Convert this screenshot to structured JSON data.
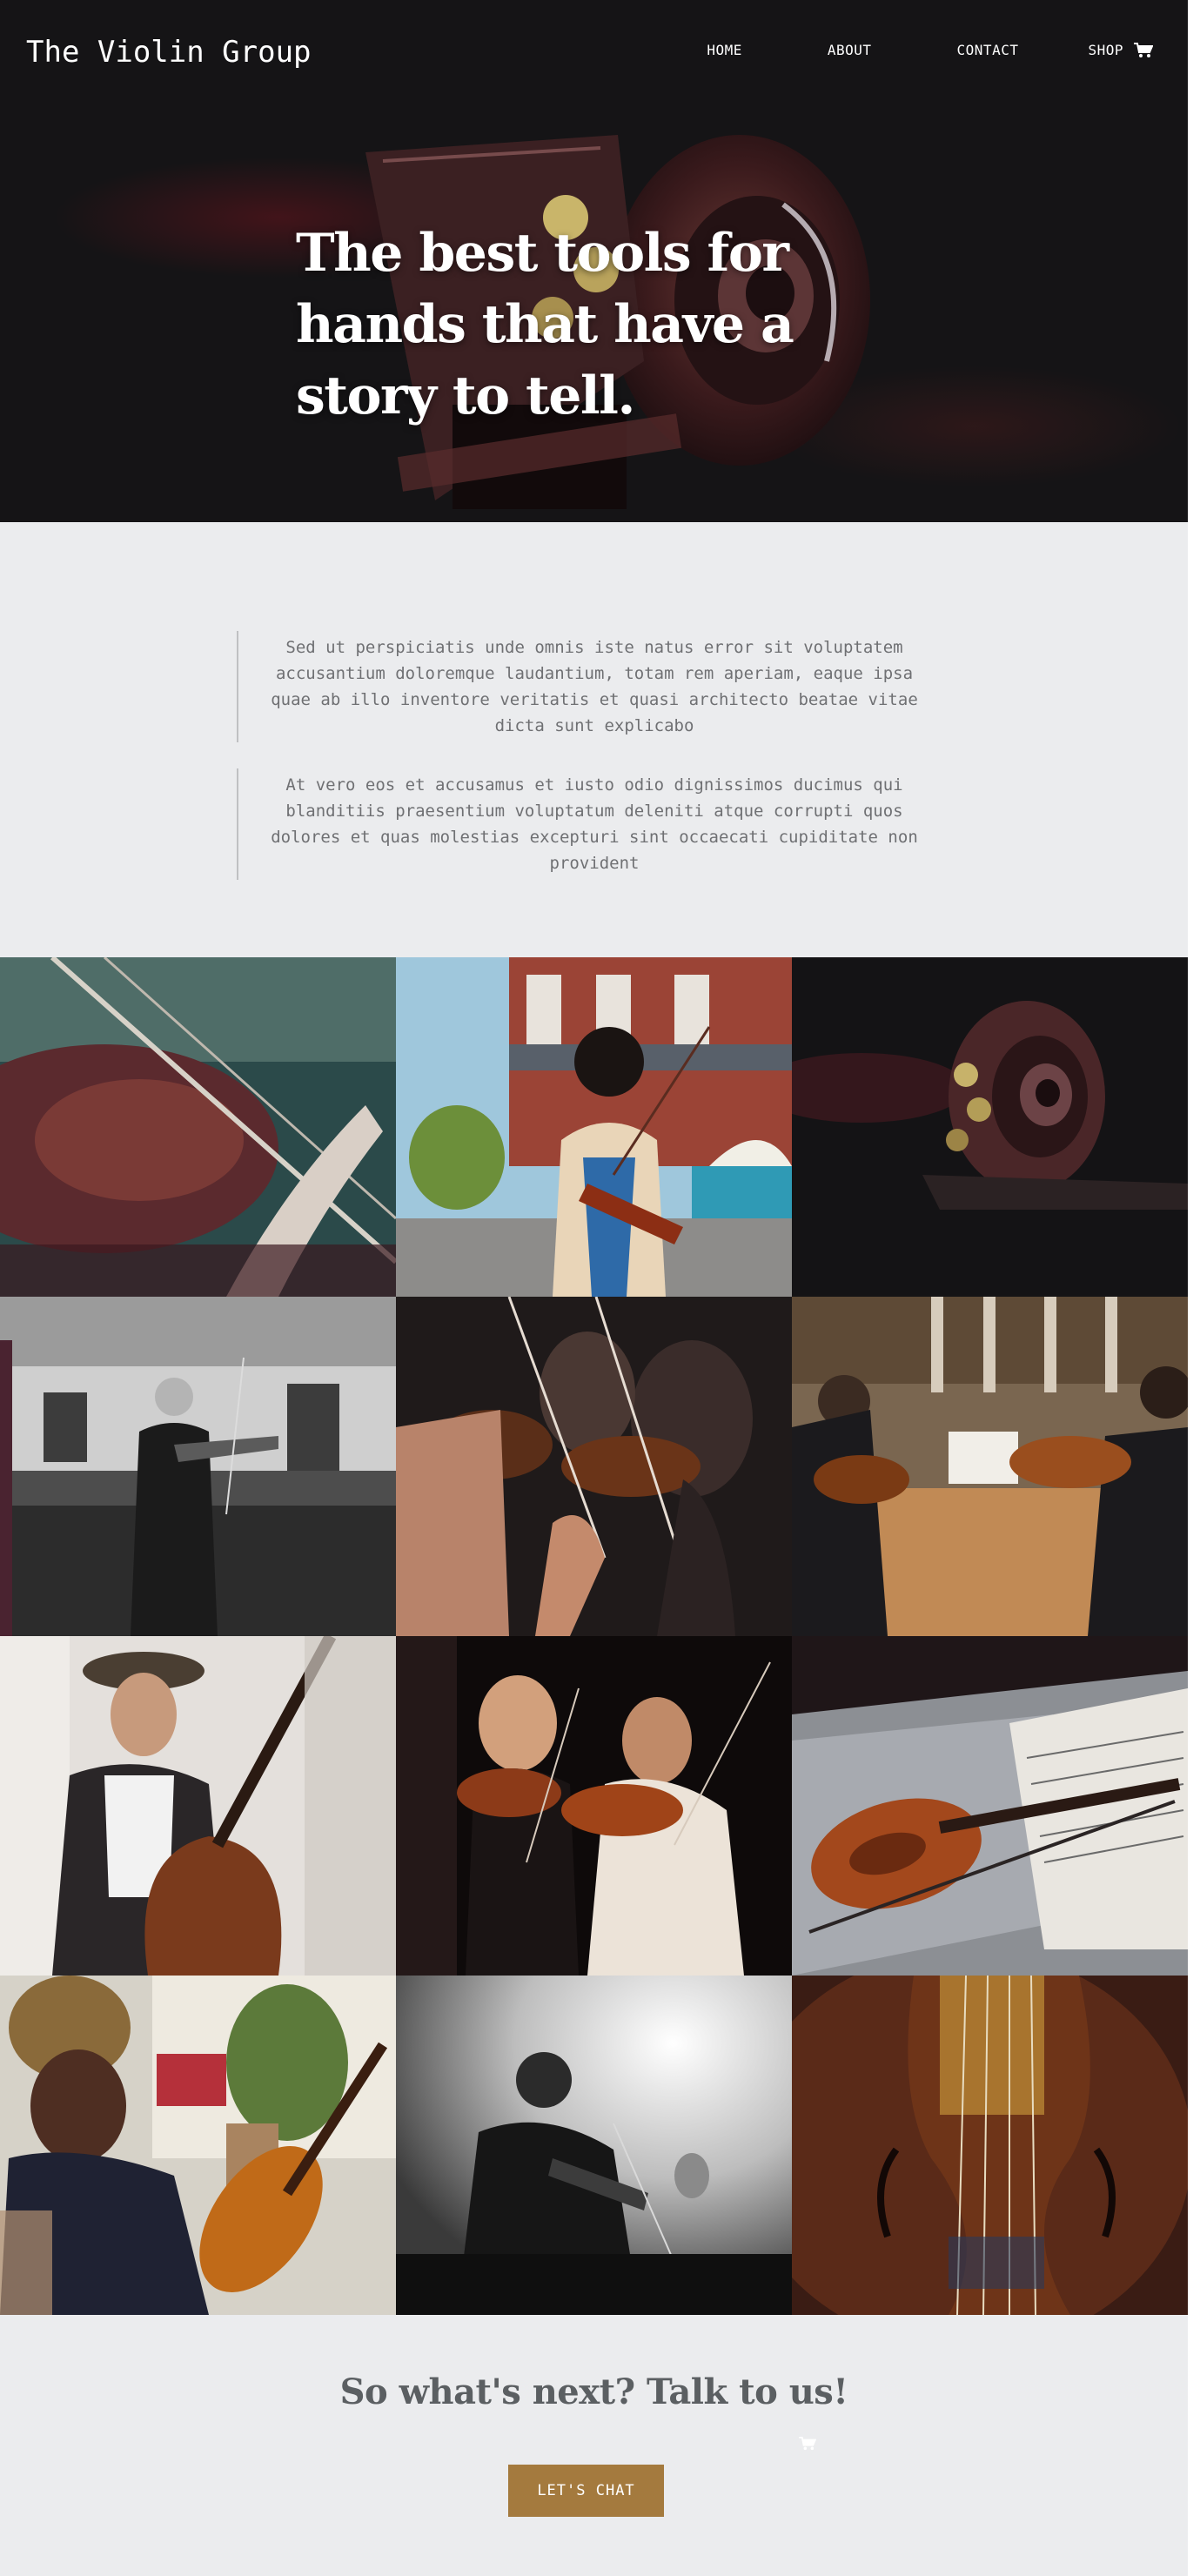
{
  "header": {
    "brand": "The Violin Group",
    "nav": {
      "home": "HOME",
      "about": "ABOUT",
      "contact": "CONTACT",
      "shop": "SHOP"
    },
    "cart_icon": "shopping-cart-icon"
  },
  "hero": {
    "title": "The best tools for hands that have a story to tell.",
    "image": "violin-scroll-photo"
  },
  "intro": {
    "paragraphs": [
      "Sed ut perspiciatis unde omnis iste natus error sit voluptatem accusantium doloremque laudantium, totam rem aperiam, eaque ipsa quae ab illo inventore veritatis et quasi architecto beatae vitae dicta sunt explicabo",
      "At vero eos et accusamus et iusto odio dignissimos ducimus qui blanditiis praesentium voluptatum deleniti atque corrupti quos dolores et quas molestias excepturi sint occaecati cupiditate non provident"
    ]
  },
  "gallery": {
    "photos": [
      "violin-closeup-photo",
      "street-violinist-photo",
      "violin-scroll-photo",
      "elderly-violinist-photo",
      "string-section-photo",
      "orchestra-hall-photo",
      "double-bass-player-photo",
      "violin-duo-photo",
      "violin-on-sheet-music-photo",
      "woman-with-violin-photo",
      "violinist-stage-light-photo",
      "violin-body-closeup-photo"
    ]
  },
  "cta": {
    "title": "So what's next? Talk to us!",
    "button": "LET'S CHAT"
  },
  "colors": {
    "hero_bg": "#151416",
    "page_bg": "#ebecee",
    "accent": "#a47a3e",
    "muted_text": "#6f7073",
    "heading_text": "#5b5f62"
  }
}
